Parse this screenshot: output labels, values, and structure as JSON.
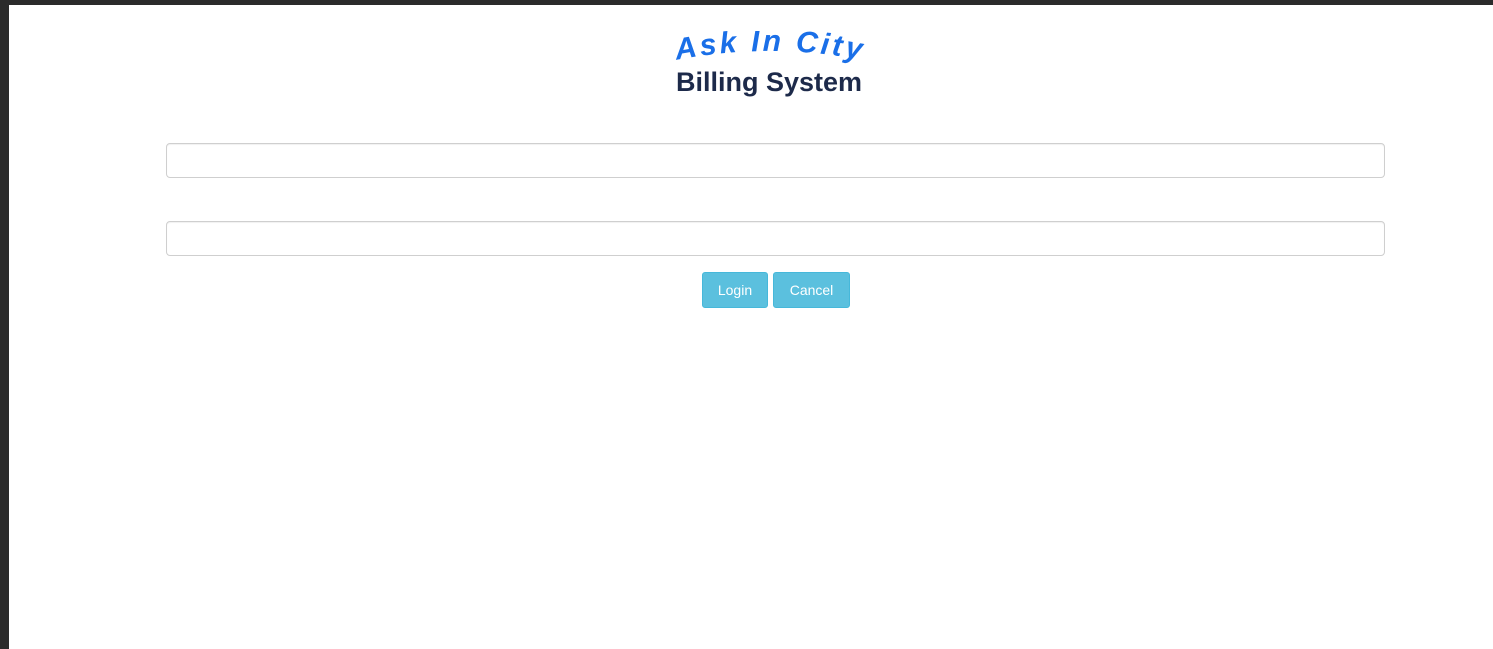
{
  "logo": {
    "arc_text": "Ask In City",
    "subtitle": "Billing System",
    "arc_color": "#1a6fe8",
    "subtitle_color": "#1d2a4a"
  },
  "form": {
    "username": {
      "value": "",
      "placeholder": ""
    },
    "password": {
      "value": "",
      "placeholder": ""
    },
    "login_label": "Login",
    "cancel_label": "Cancel"
  },
  "colors": {
    "button_bg": "#5bc0de",
    "button_border": "#46b8da",
    "window_border": "#2b2b2b"
  }
}
